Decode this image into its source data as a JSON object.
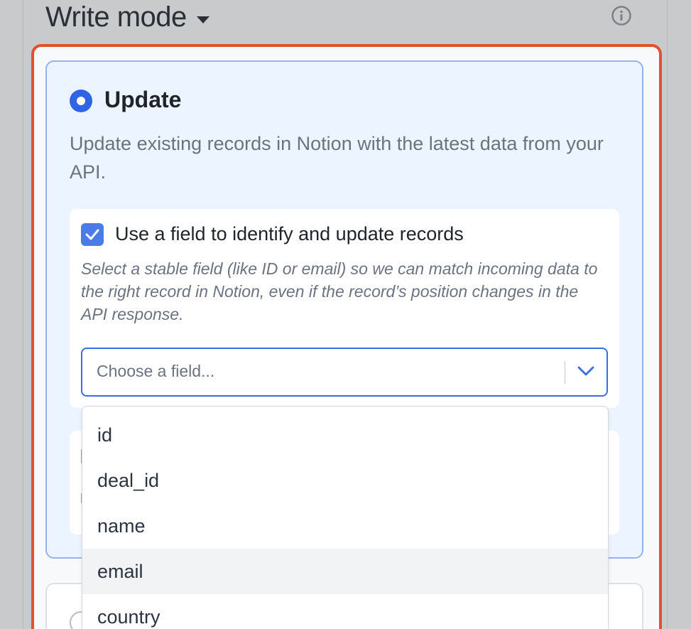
{
  "header": {
    "title": "Write mode"
  },
  "update_option": {
    "label": "Update",
    "description": "Update existing records in Notion with the latest data from your API.",
    "selected": true
  },
  "identify": {
    "checked": true,
    "label": "Use a field to identify and update records",
    "description": "Select a stable field (like ID or email) so we can match incoming data to the right record in Notion, even if the record’s position changes in the API response."
  },
  "field_select": {
    "placeholder": "Choose a field..."
  },
  "dropdown": {
    "options": [
      "id",
      "deal_id",
      "name",
      "email",
      "country"
    ],
    "hovered": "email"
  },
  "colors": {
    "accent": "#2f64e4",
    "highlight_border": "#e2502e",
    "card_bg": "#ecf4ff"
  }
}
